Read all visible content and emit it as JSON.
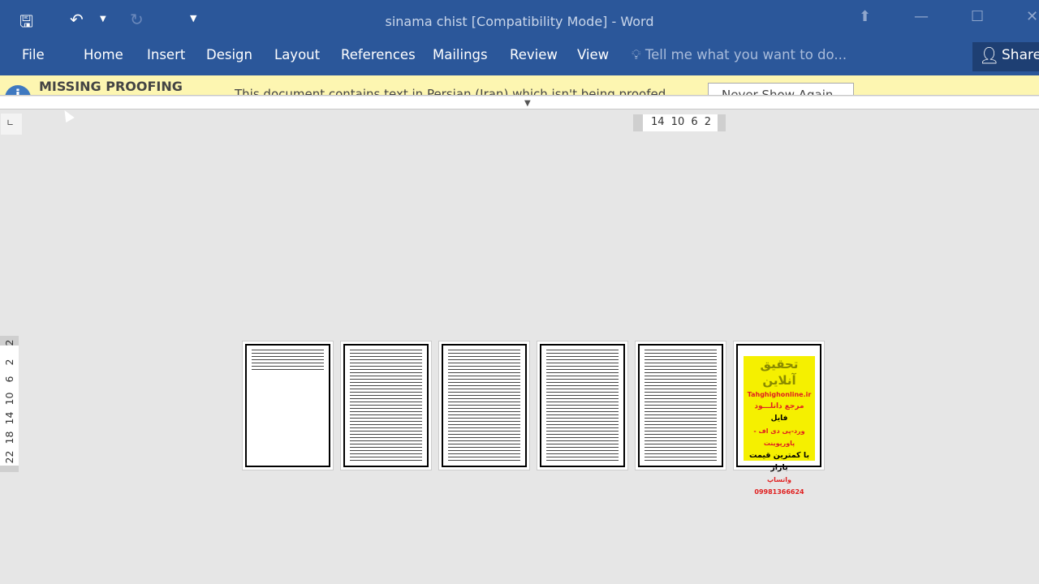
{
  "window": {
    "title": "sinama chist [Compatibility Mode] - Word"
  },
  "quick_access": {
    "save": "save-icon",
    "undo": "undo-icon",
    "redo": "redo-icon",
    "customize": "customize-icon"
  },
  "ribbon": {
    "tabs": [
      "File",
      "Home",
      "Insert",
      "Design",
      "Layout",
      "References",
      "Mailings",
      "Review",
      "View"
    ],
    "tell_me": "Tell me what you want to do...",
    "share": "Share"
  },
  "message_bar": {
    "title": "MISSING PROOFING",
    "text": "This document contains text in Persian (Iran) which isn't being proofed.",
    "button": "Never Show Again"
  },
  "horizontal_ruler": {
    "labels": "14 10 6 2"
  },
  "vertical_ruler": {
    "labels": [
      "2",
      "2",
      "6",
      "10",
      "14",
      "18",
      "22"
    ]
  },
  "ad_page": {
    "title": "تحقیق آنلاین",
    "site": "Tahghighonline.ir",
    "line1": "مرجع دانلـــود",
    "line2": "فایل",
    "line3": "ورد-پی دی اف - پاورپوینت",
    "line4": "با کمترین قیمت بازار",
    "phone": "09981366624",
    "whatsapp": "واتساپ"
  },
  "colors": {
    "ribbon": "#2b579a",
    "message_bar": "#fdf6b1",
    "ad_background": "#f5f000"
  }
}
